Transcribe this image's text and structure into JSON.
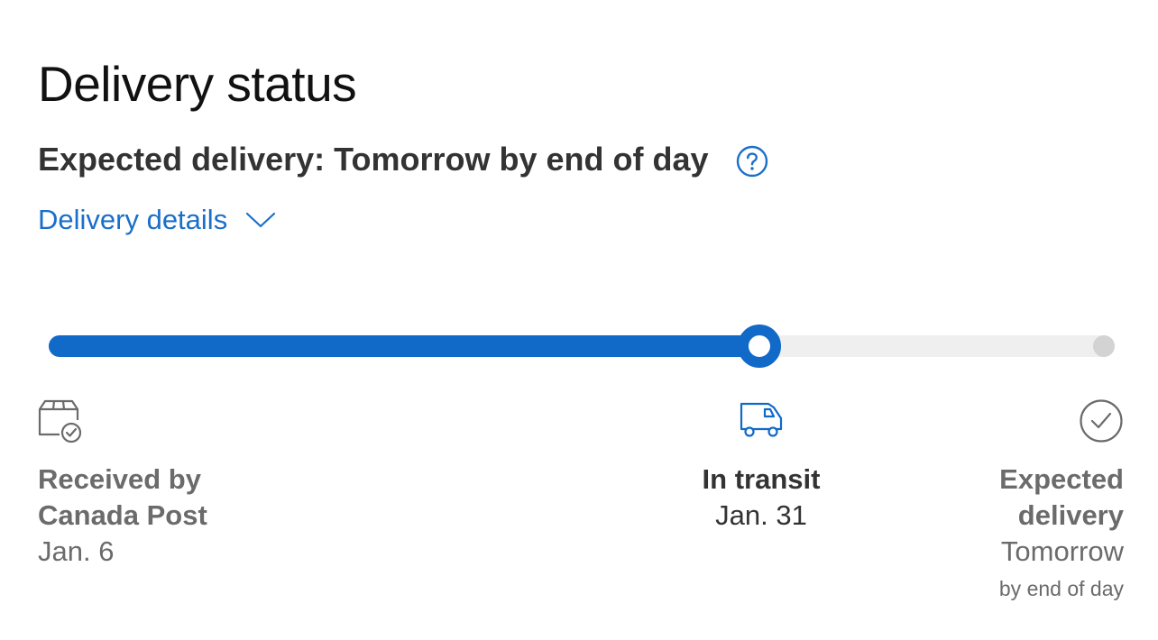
{
  "page": {
    "title": "Delivery status"
  },
  "expected": {
    "text": "Expected delivery: Tomorrow by end of day",
    "help_icon": "question-circle-icon"
  },
  "details": {
    "label": "Delivery details",
    "icon": "chevron-down-icon"
  },
  "progress": {
    "fraction": 0.667,
    "current_step": 2,
    "total_steps": 3
  },
  "milestones": [
    {
      "icon": "package-check-icon",
      "title_line1": "Received by",
      "title_line2": "Canada Post",
      "date": "Jan. 6"
    },
    {
      "icon": "delivery-truck-icon",
      "title": "In transit",
      "date": "Jan. 31"
    },
    {
      "icon": "check-circle-icon",
      "title_line1": "Expected",
      "title_line2": "delivery",
      "date": "Tomorrow",
      "note": "by end of day"
    }
  ],
  "colors": {
    "accent": "#1169c8",
    "link": "#1a6fc9",
    "track_empty": "#efefef",
    "step_pending": "#d3d3d3",
    "muted_text": "#6b6b6b"
  }
}
